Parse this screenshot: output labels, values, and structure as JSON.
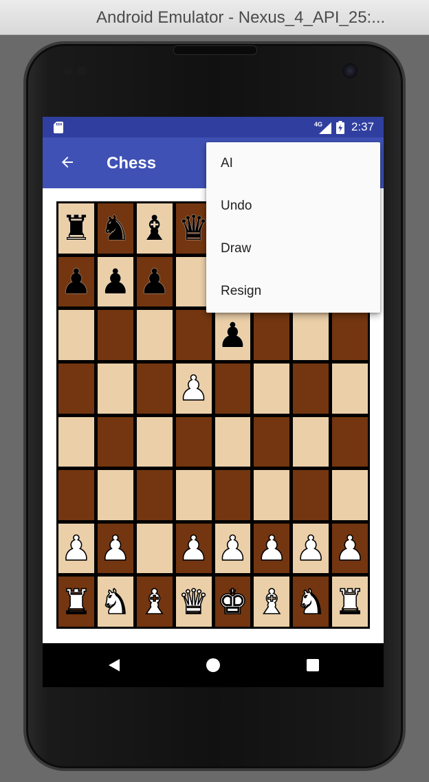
{
  "window": {
    "title": "Android Emulator - Nexus_4_API_25:..."
  },
  "status_bar": {
    "network": "4G",
    "time": "2:37",
    "color": "#303f9f",
    "icons": [
      "sd-card-icon",
      "signal-icon",
      "battery-icon"
    ]
  },
  "app_bar": {
    "title": "Chess",
    "color": "#3f51b5",
    "back_icon": "arrow-back-icon"
  },
  "overflow_menu": {
    "items": [
      "AI",
      "Undo",
      "Draw",
      "Resign"
    ]
  },
  "board": {
    "light_color": "#ebcfa8",
    "dark_color": "#733610",
    "rows": [
      [
        "r",
        "n",
        "b",
        "q",
        "",
        "",
        "",
        ""
      ],
      [
        "p",
        "p",
        "p",
        "",
        "",
        "",
        "",
        ""
      ],
      [
        "",
        "",
        "",
        "",
        "p",
        "",
        "",
        ""
      ],
      [
        "",
        "",
        "",
        "P",
        "",
        "",
        "",
        ""
      ],
      [
        "",
        "",
        "",
        "",
        "",
        "",
        "",
        ""
      ],
      [
        "",
        "",
        "",
        "",
        "",
        "",
        "",
        ""
      ],
      [
        "P",
        "P",
        "",
        "P",
        "P",
        "P",
        "P",
        "P"
      ],
      [
        "R",
        "N",
        "B",
        "Q",
        "K",
        "B",
        "N",
        "R"
      ]
    ]
  },
  "nav_bar": {
    "icons": [
      "nav-back-icon",
      "nav-home-icon",
      "nav-recents-icon"
    ]
  }
}
